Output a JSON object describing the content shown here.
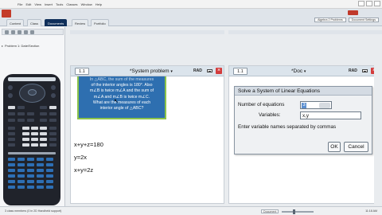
{
  "menubar": {
    "items": [
      "File",
      "Edit",
      "View",
      "Insert",
      "Tools",
      "Classes",
      "Window",
      "Help"
    ]
  },
  "tabs": [
    "Content",
    "Class",
    "Documents",
    "Review",
    "Portfolio"
  ],
  "active_tab": "Documents",
  "header_right": {
    "dropdown": "Algebra 2 Problems",
    "settings": "Document Settings"
  },
  "left_panel": {
    "document_name": "Problem 1: Date/Section"
  },
  "pane1": {
    "tab": "1.1",
    "title": "*System problem",
    "mode": "RAD",
    "problem_lines": [
      "In △ABC, the sum of the measures",
      "of the interior angles is 180°. Also",
      "m∠B is twice m∠A and the sum of",
      "m∠A and m∠B is twice m∠C.",
      "What are the measures of each",
      "interior angle of △ABC?"
    ],
    "equations": [
      "x+y+z=180",
      "y=2x",
      "x+y=2z"
    ]
  },
  "pane2": {
    "tab": "1.1",
    "title": "*Doc",
    "mode": "RAD",
    "dialog": {
      "title": "Solve a System of Linear Equations",
      "num_eq_label": "Number of equations",
      "num_eq_value": "3",
      "variables_label": "Variables:",
      "variables_value": "x,y",
      "hint": "Enter variable names separated by commas",
      "ok_label": "OK",
      "cancel_label": "Cancel"
    }
  },
  "statusbar": {
    "left": "3 class members (0 in 2D Handheld support)",
    "document": "Document",
    "right": "11:18 AM"
  },
  "colors": {
    "problem_fill": "#2e6fb0",
    "problem_border": "#8bc34a",
    "close_red": "#d33b3b",
    "active_tab": "#0f2f5a"
  },
  "icons": [
    "close-icon",
    "battery-icon",
    "dropdown-arrow-icon",
    "cursor-icon",
    "spinner-icon"
  ]
}
